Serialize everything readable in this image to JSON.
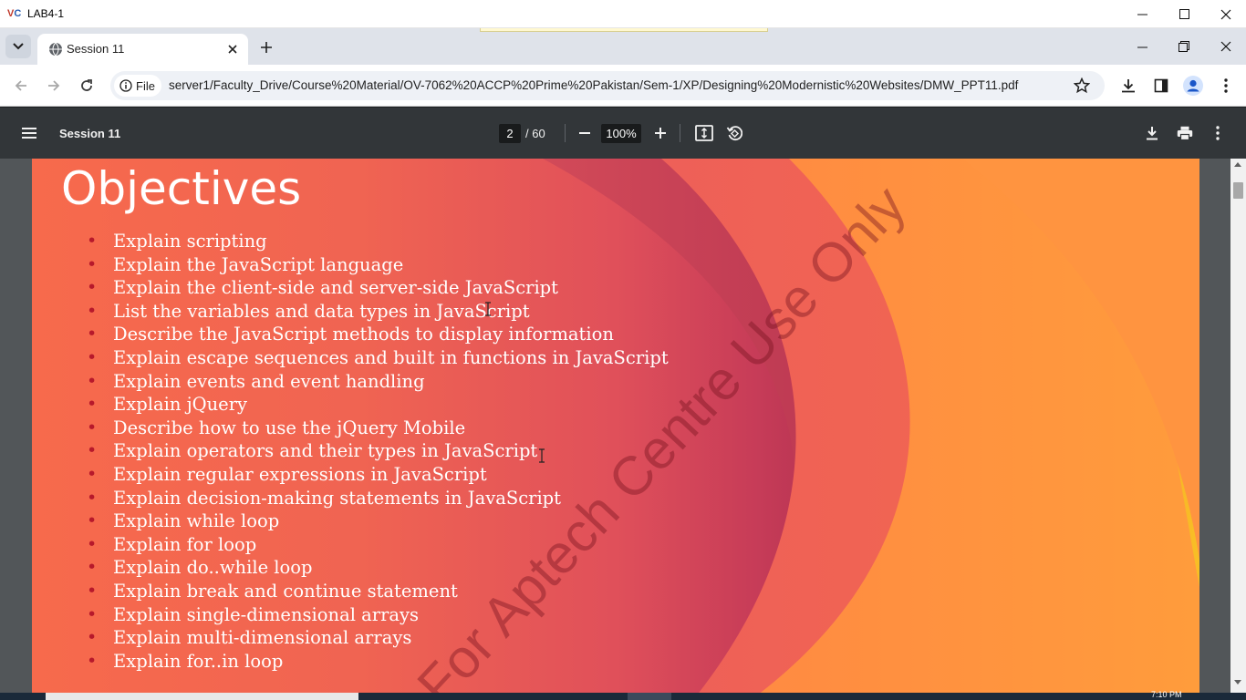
{
  "vm_window": {
    "title": "LAB4-1",
    "logo_text_v": "V",
    "logo_text_c": "C"
  },
  "browser": {
    "tab_title": "Session 11",
    "address": {
      "site_chip": "File",
      "url": "server1/Faculty_Drive/Course%20Material/OV-7062%20ACCP%20Prime%20Pakistan/Sem-1/XP/Designing%20Modernistic%20Websites/DMW_PPT11.pdf"
    }
  },
  "pdf_viewer": {
    "title": "Session 11",
    "current_page": "2",
    "total_pages": "/ 60",
    "zoom": "100%"
  },
  "slide": {
    "heading": "Objectives",
    "objectives": [
      "Explain scripting",
      "Explain the JavaScript language",
      "Explain the client-side and server-side JavaScript",
      "List the variables and data types in JavaScript",
      "Describe the JavaScript methods to display information",
      "Explain escape sequences and built in functions in JavaScript",
      "Explain events and event handling",
      "Explain jQuery",
      "Describe how to use the jQuery Mobile",
      "Explain operators and their types in JavaScript",
      "Explain regular expressions in JavaScript",
      "Explain decision-making statements in JavaScript",
      "Explain while loop",
      "Explain for loop",
      "Explain do..while loop",
      "Explain break and continue statement",
      "Explain single-dimensional arrays",
      "Explain multi-dimensional arrays",
      "Explain for..in loop"
    ],
    "watermark": "For Aptech Centre Use Only"
  },
  "taskbar": {
    "clock": "7:10 PM"
  },
  "colors": {
    "pdf_toolbar": "#323639",
    "viewport_bg": "#525659",
    "slide_coral": "#f76a4c",
    "slide_orange": "#ff8c40",
    "slide_yellow": "#f7b928",
    "bullet_red": "#b7192b"
  }
}
